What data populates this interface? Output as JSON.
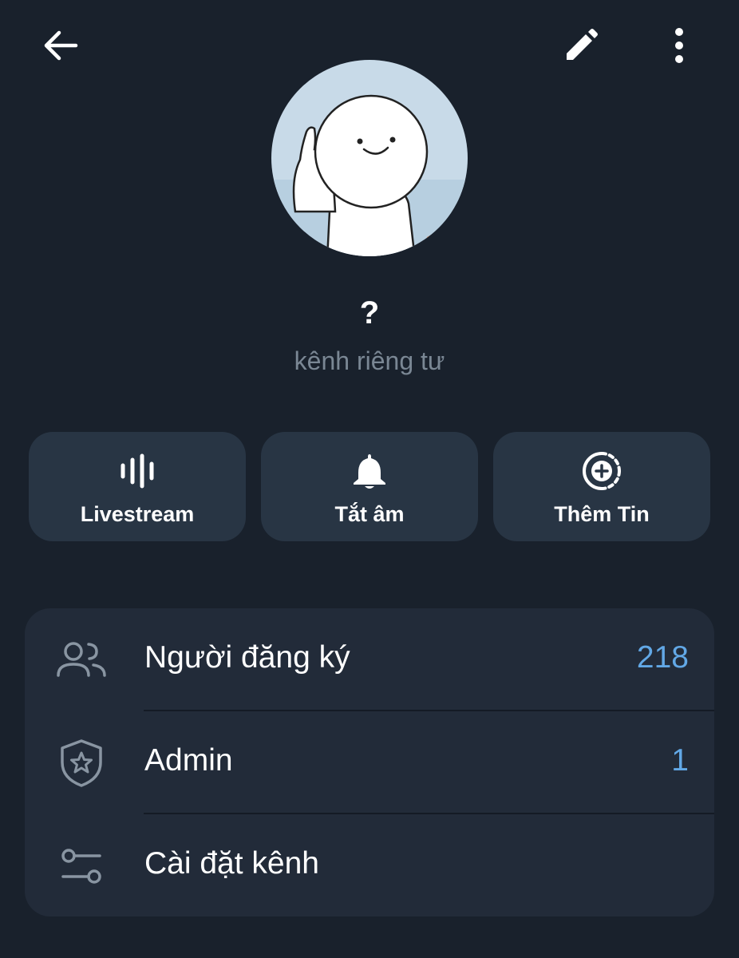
{
  "header": {
    "back_icon": "arrow-left-icon",
    "edit_icon": "pencil-icon",
    "more_icon": "more-vertical-icon"
  },
  "profile": {
    "avatar_icon": "cartoon-avatar",
    "name": "?",
    "subtitle": "kênh riêng tư"
  },
  "actions": [
    {
      "label": "Livestream",
      "icon": "waveform-icon"
    },
    {
      "label": "Tắt âm",
      "icon": "bell-icon"
    },
    {
      "label": "Thêm Tin",
      "icon": "add-story-icon"
    }
  ],
  "info": {
    "rows": [
      {
        "label": "Người đăng ký",
        "value": "218",
        "icon": "people-icon"
      },
      {
        "label": "Admin",
        "value": "1",
        "icon": "shield-star-icon"
      },
      {
        "label": "Cài đặt kênh",
        "value": "",
        "icon": "sliders-icon"
      }
    ]
  },
  "colors": {
    "background": "#19212c",
    "button_bg": "#283544",
    "card_bg": "#222b39",
    "accent": "#62a8e6",
    "muted_text": "#7a8794"
  }
}
